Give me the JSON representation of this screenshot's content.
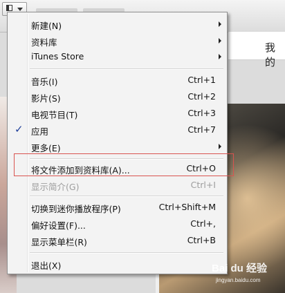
{
  "background": {
    "right_label": "我的"
  },
  "menu": {
    "items": [
      {
        "label": "新建(N)",
        "shortcut": "",
        "submenu": true,
        "checked": false,
        "disabled": false
      },
      {
        "label": "资料库",
        "shortcut": "",
        "submenu": true,
        "checked": false,
        "disabled": false
      },
      {
        "label": "iTunes Store",
        "shortcut": "",
        "submenu": true,
        "checked": false,
        "disabled": false
      },
      {
        "label": "音乐(I)",
        "shortcut": "Ctrl+1",
        "submenu": false,
        "checked": false,
        "disabled": false
      },
      {
        "label": "影片(S)",
        "shortcut": "Ctrl+2",
        "submenu": false,
        "checked": false,
        "disabled": false
      },
      {
        "label": "电视节目(T)",
        "shortcut": "Ctrl+3",
        "submenu": false,
        "checked": false,
        "disabled": false
      },
      {
        "label": "应用",
        "shortcut": "Ctrl+7",
        "submenu": false,
        "checked": true,
        "disabled": false
      },
      {
        "label": "更多(E)",
        "shortcut": "",
        "submenu": true,
        "checked": false,
        "disabled": false
      },
      {
        "label": "将文件添加到资料库(A)...",
        "shortcut": "Ctrl+O",
        "submenu": false,
        "checked": false,
        "disabled": false
      },
      {
        "label": "显示简介(G)",
        "shortcut": "Ctrl+I",
        "submenu": false,
        "checked": false,
        "disabled": true
      },
      {
        "label": "切换到迷你播放程序(P)",
        "shortcut": "Ctrl+Shift+M",
        "submenu": false,
        "checked": false,
        "disabled": false
      },
      {
        "label": "偏好设置(F)...",
        "shortcut": "Ctrl+,",
        "submenu": false,
        "checked": false,
        "disabled": false
      },
      {
        "label": "显示菜单栏(R)",
        "shortcut": "Ctrl+B",
        "submenu": false,
        "checked": false,
        "disabled": false
      },
      {
        "label": "退出(X)",
        "shortcut": "",
        "submenu": false,
        "checked": false,
        "disabled": false
      }
    ],
    "check_glyph": "✓"
  },
  "colors": {
    "highlight_box": "#d9534f",
    "check_mark": "#1f3f9a"
  },
  "watermark": {
    "logo": "Bai du 经验",
    "url": "jingyan.baidu.com"
  }
}
